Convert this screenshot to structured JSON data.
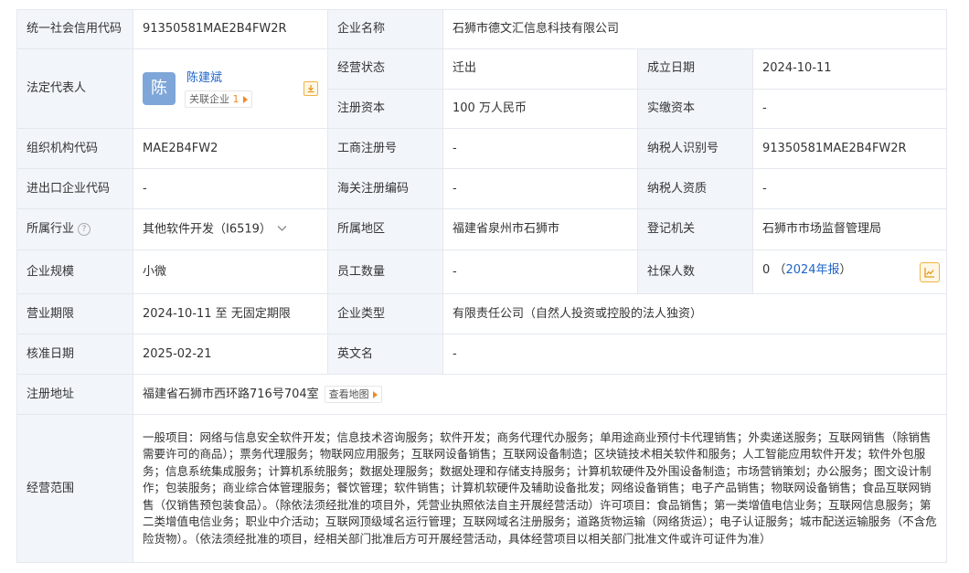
{
  "rows": {
    "credit_code": {
      "label": "统一社会信用代码",
      "value": "91350581MAE2B4FW2R"
    },
    "company_name": {
      "label": "企业名称",
      "value": "石狮市德文汇信息科技有限公司"
    },
    "legal_rep": {
      "label": "法定代表人",
      "avatar_char": "陈",
      "name": "陈建斌",
      "related_label": "关联企业",
      "related_count": "1"
    },
    "status": {
      "label": "经营状态",
      "value": "迁出"
    },
    "established": {
      "label": "成立日期",
      "value": "2024-10-11"
    },
    "reg_capital": {
      "label": "注册资本",
      "value": "100 万人民币"
    },
    "paid_capital": {
      "label": "实缴资本",
      "value": "-"
    },
    "org_code": {
      "label": "组织机构代码",
      "value": "MAE2B4FW2"
    },
    "business_reg_no": {
      "label": "工商注册号",
      "value": "-"
    },
    "taxpayer_id": {
      "label": "纳税人识别号",
      "value": "91350581MAE2B4FW2R"
    },
    "import_export_code": {
      "label": "进出口企业代码",
      "value": "-"
    },
    "customs_code": {
      "label": "海关注册编码",
      "value": "-"
    },
    "taxpayer_qual": {
      "label": "纳税人资质",
      "value": "-"
    },
    "industry": {
      "label": "所属行业",
      "value": "其他软件开发（I6519）"
    },
    "region": {
      "label": "所属地区",
      "value": "福建省泉州市石狮市"
    },
    "authority": {
      "label": "登记机关",
      "value": "石狮市市场监督管理局"
    },
    "scale": {
      "label": "企业规模",
      "value": "小微"
    },
    "staff": {
      "label": "员工数量",
      "value": "-"
    },
    "insured": {
      "label": "社保人数",
      "value": "0",
      "report_prefix": "（",
      "report_link": "2024年报",
      "report_suffix": "）"
    },
    "term": {
      "label": "营业期限",
      "value": "2024-10-11 至 无固定期限"
    },
    "company_type": {
      "label": "企业类型",
      "value": "有限责任公司（自然人投资或控股的法人独资）"
    },
    "approval_date": {
      "label": "核准日期",
      "value": "2025-02-21"
    },
    "english_name": {
      "label": "英文名",
      "value": "-"
    },
    "address": {
      "label": "注册地址",
      "value": "福建省石狮市西环路716号704室",
      "map_button": "查看地图"
    },
    "scope": {
      "label": "经营范围",
      "value": "一般项目：网络与信息安全软件开发；信息技术咨询服务；软件开发；商务代理代办服务；单用途商业预付卡代理销售；外卖递送服务；互联网销售（除销售需要许可的商品）；票务代理服务；物联网应用服务；互联网设备销售；互联网设备制造；区块链技术相关软件和服务；人工智能应用软件开发；软件外包服务；信息系统集成服务；计算机系统服务；数据处理服务；数据处理和存储支持服务；计算机软硬件及外围设备制造；市场营销策划；办公服务；图文设计制作；包装服务；商业综合体管理服务；餐饮管理；软件销售；计算机软硬件及辅助设备批发；网络设备销售；电子产品销售；物联网设备销售；食品互联网销售（仅销售预包装食品）。（除依法须经批准的项目外，凭营业执照依法自主开展经营活动）许可项目：食品销售；第一类增值电信业务；互联网信息服务；第二类增值电信业务；职业中介活动；互联网顶级域名运行管理；互联网域名注册服务；道路货物运输（网络货运）；电子认证服务；城市配送运输服务（不含危险货物）。（依法须经批准的项目，经相关部门批准后方可开展经营活动，具体经营项目以相关部门批准文件或许可证件为准）"
    }
  },
  "icons": {
    "download": "download-icon",
    "help": "question-circle-icon",
    "chevron": "chevron-down-icon",
    "chart": "line-chart-icon"
  },
  "colors": {
    "label_bg": "#f2f6fb",
    "link": "#1f64c9",
    "accent": "#f08a24",
    "border": "#e4e8ee",
    "avatar_bg": "#7fa6d8"
  }
}
